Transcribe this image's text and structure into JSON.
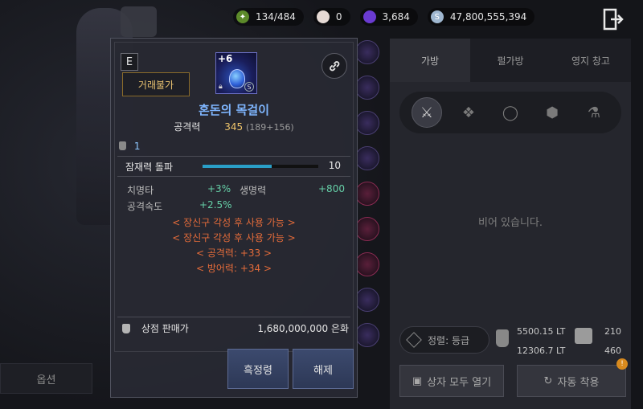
{
  "topbar": {
    "energy": "134/484",
    "pearl": "0",
    "crystal": "3,684",
    "silver": "47,800,555,394"
  },
  "left": {
    "option_label": "옵션"
  },
  "inventory": {
    "tabs": [
      "가방",
      "펄가방",
      "영지 창고"
    ],
    "categories": [
      "sword-icon",
      "armor-icon",
      "ring-icon",
      "crystal-icon",
      "potion-icon"
    ],
    "empty_text": "비어 있습니다.",
    "sort_label": "정렬: 등급",
    "weight_current": "5500.15 LT",
    "weight_max": "12306.7 LT",
    "slots_used": "210",
    "slots_max": "460",
    "open_all_label": "상자 모두 열기",
    "auto_equip_label": "자동 착용",
    "notification_badge": "!"
  },
  "tooltip": {
    "grade": "E",
    "trade_status": "거래불가",
    "enhance_level": "+6",
    "name": "혼돈의 목걸이",
    "attack_label": "공격력",
    "attack_value": "345",
    "attack_detail": "(189+156)",
    "count": "1",
    "breakthrough_label": "잠재력 돌파",
    "breakthrough_value": "10",
    "breakthrough_fill": 0.6,
    "stats": [
      {
        "name": "치명타",
        "value": "+3%"
      },
      {
        "name": "생명력",
        "value": "+800"
      },
      {
        "name": "공격속도",
        "value": "+2.5%"
      }
    ],
    "orange_lines": [
      "< 장신구 각성 후 사용 가능 >",
      "< 장신구 각성 후 사용 가능 >",
      "< 공격력: +33 >",
      "< 방어력: +34 >"
    ],
    "sell_label": "상점 판매가",
    "sell_price": "1,680,000,000 은화",
    "black_spirit_label": "흑정령",
    "release_label": "해제"
  }
}
